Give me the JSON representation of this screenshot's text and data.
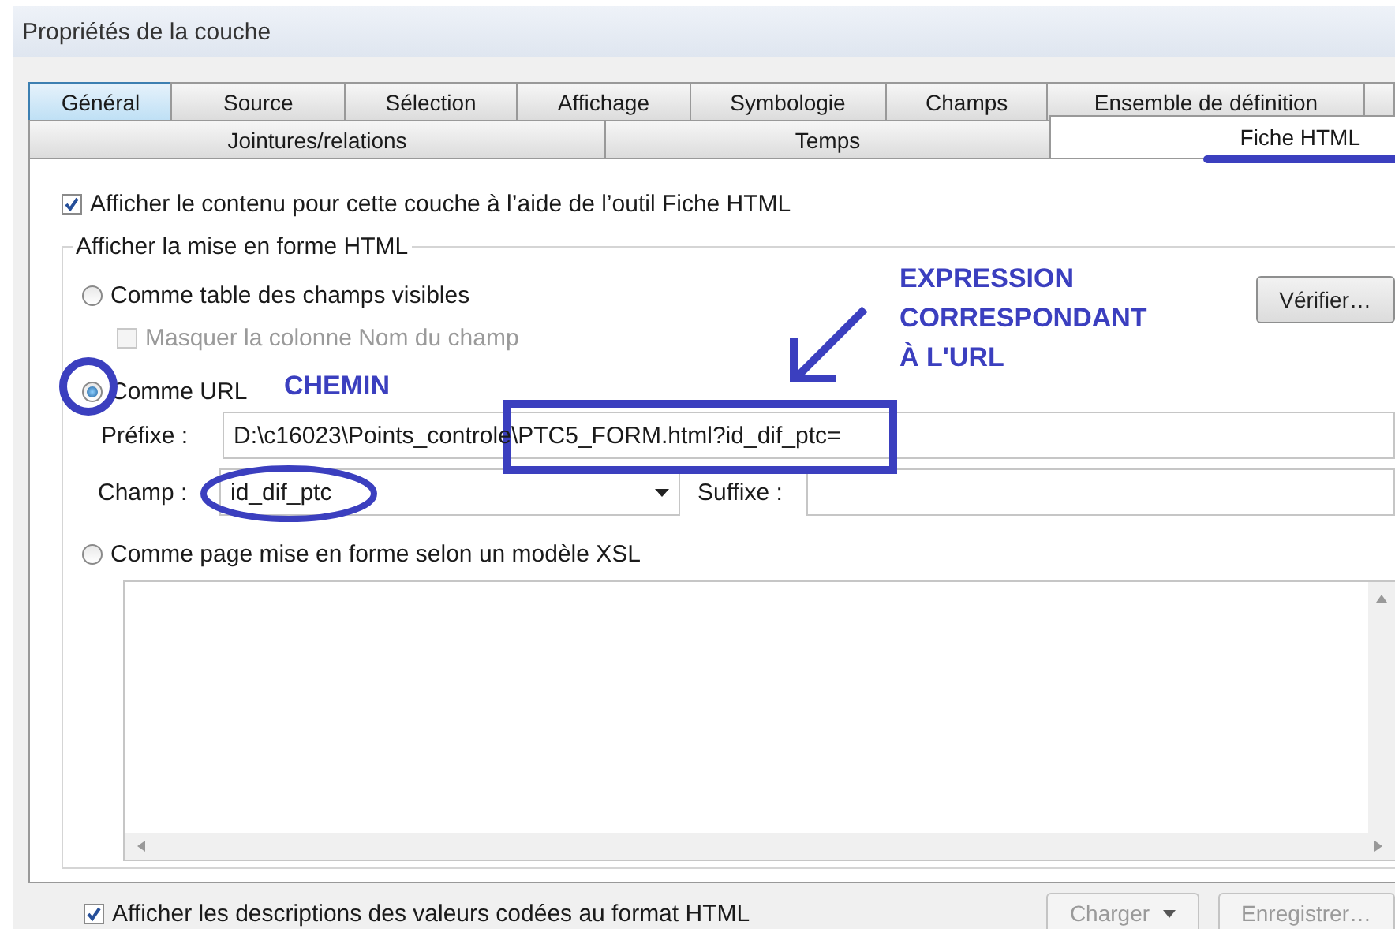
{
  "window": {
    "title": "Propriétés de la couche"
  },
  "tabs_row1": [
    {
      "label": "Général",
      "selected": false,
      "hover": true
    },
    {
      "label": "Source",
      "selected": false,
      "hover": false
    },
    {
      "label": "Sélection",
      "selected": false,
      "hover": false
    },
    {
      "label": "Affichage",
      "selected": false,
      "hover": false
    },
    {
      "label": "Symbologie",
      "selected": false,
      "hover": false
    },
    {
      "label": "Champs",
      "selected": false,
      "hover": false
    },
    {
      "label": "Ensemble de définition",
      "selected": false,
      "hover": false
    }
  ],
  "tabs_row2": [
    {
      "label": "Jointures/relations",
      "selected": false
    },
    {
      "label": "Temps",
      "selected": false
    },
    {
      "label": "Fiche HTML",
      "selected": true
    }
  ],
  "show_content": {
    "label": "Afficher le contenu pour cette couche à l’aide de l’outil Fiche HTML",
    "checked": true
  },
  "group": {
    "title": "Afficher la mise en forme HTML"
  },
  "options": [
    {
      "label": "Comme table des champs visibles",
      "selected": false
    },
    {
      "label": "Comme URL",
      "selected": true
    },
    {
      "label": "Comme page mise en forme selon un modèle XSL",
      "selected": false
    }
  ],
  "hide_field_name": {
    "label": "Masquer la colonne Nom du champ",
    "checked": false,
    "disabled": true
  },
  "verify_button": "Vérifier…",
  "prefix": {
    "label": "Préfixe :",
    "value": "D:\\c16023\\Points_controle\\PTC5_FORM.html?id_dif_ptc="
  },
  "field": {
    "label": "Champ :",
    "value": "id_dif_ptc"
  },
  "suffix": {
    "label": "Suffixe :"
  },
  "coded_values": {
    "label": "Afficher les descriptions des valeurs codées au format HTML",
    "checked": true
  },
  "buttons": [
    {
      "label": "Charger",
      "disabled": true,
      "dropdown": true
    },
    {
      "label": "Enregistrer…",
      "disabled": true,
      "dropdown": false
    }
  ],
  "annotations": {
    "path_label": "CHEMIN",
    "expression_label": [
      "EXPRESSION",
      "CORRESPONDANT",
      "À L'URL"
    ]
  }
}
